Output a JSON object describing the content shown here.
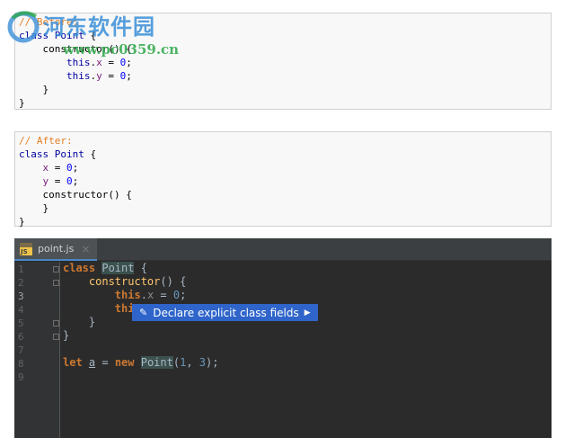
{
  "before_box": {
    "lines": [
      {
        "parts": [
          {
            "t": "// Before:",
            "c": "cmt"
          }
        ]
      },
      {
        "parts": [
          {
            "t": "class ",
            "c": "kw"
          },
          {
            "t": "Point ",
            "c": "cls"
          },
          {
            "t": "{",
            "c": ""
          }
        ]
      },
      {
        "parts": [
          {
            "t": "    constructor() {",
            "c": ""
          }
        ]
      },
      {
        "parts": [
          {
            "t": "        this",
            "c": "kw"
          },
          {
            "t": ".",
            "c": ""
          },
          {
            "t": "x",
            "c": "prop"
          },
          {
            "t": " = ",
            "c": ""
          },
          {
            "t": "0",
            "c": "num"
          },
          {
            "t": ";",
            "c": ""
          }
        ]
      },
      {
        "parts": [
          {
            "t": "        this",
            "c": "kw"
          },
          {
            "t": ".",
            "c": ""
          },
          {
            "t": "y",
            "c": "prop"
          },
          {
            "t": " = ",
            "c": ""
          },
          {
            "t": "0",
            "c": "num"
          },
          {
            "t": ";",
            "c": ""
          }
        ]
      },
      {
        "parts": [
          {
            "t": "    }",
            "c": ""
          }
        ]
      },
      {
        "parts": [
          {
            "t": "}",
            "c": ""
          }
        ]
      }
    ]
  },
  "after_box": {
    "lines": [
      {
        "parts": [
          {
            "t": "// After:",
            "c": "cmt"
          }
        ]
      },
      {
        "parts": [
          {
            "t": "class ",
            "c": "kw"
          },
          {
            "t": "Point ",
            "c": "cls"
          },
          {
            "t": "{",
            "c": ""
          }
        ]
      },
      {
        "parts": [
          {
            "t": "    x",
            "c": "prop"
          },
          {
            "t": " = ",
            "c": ""
          },
          {
            "t": "0",
            "c": "num"
          },
          {
            "t": ";",
            "c": ""
          }
        ]
      },
      {
        "parts": [
          {
            "t": "    y",
            "c": "prop"
          },
          {
            "t": " = ",
            "c": ""
          },
          {
            "t": "0",
            "c": "num"
          },
          {
            "t": ";",
            "c": ""
          }
        ]
      },
      {
        "parts": [
          {
            "t": "    constructor() {",
            "c": ""
          }
        ]
      },
      {
        "parts": [
          {
            "t": "    }",
            "c": ""
          }
        ]
      },
      {
        "parts": [
          {
            "t": "}",
            "c": ""
          }
        ]
      }
    ]
  },
  "watermark": {
    "title": "河东软件园",
    "url": "www.pc0359.cn"
  },
  "editor": {
    "tab": {
      "label": "point.js",
      "icon_text": "JS",
      "close": "×"
    },
    "line_numbers": [
      "1",
      "2",
      "3",
      "4",
      "5",
      "6",
      "7",
      "8",
      "9"
    ],
    "active_line": "3",
    "code_lines": [
      {
        "parts": [
          {
            "t": "class ",
            "c": "d-kw"
          },
          {
            "t": "Point",
            "c": "d-cls"
          },
          {
            "t": " {",
            "c": ""
          }
        ]
      },
      {
        "parts": [
          {
            "t": "    ",
            "c": ""
          },
          {
            "t": "constructor",
            "c": "d-fn"
          },
          {
            "t": "() {",
            "c": ""
          }
        ]
      },
      {
        "parts": [
          {
            "t": "        ",
            "c": ""
          },
          {
            "t": "this",
            "c": "d-this"
          },
          {
            "t": ".",
            "c": ""
          },
          {
            "t": "x",
            "c": "d-dim"
          },
          {
            "t": " = ",
            "c": ""
          },
          {
            "t": "0",
            "c": "d-num"
          },
          {
            "t": ";",
            "c": ""
          }
        ]
      },
      {
        "parts": [
          {
            "t": "        ",
            "c": ""
          },
          {
            "t": "thi",
            "c": "d-this"
          }
        ]
      },
      {
        "parts": [
          {
            "t": "    }",
            "c": ""
          }
        ]
      },
      {
        "parts": [
          {
            "t": "}",
            "c": ""
          }
        ]
      },
      {
        "parts": [
          {
            "t": "",
            "c": ""
          }
        ]
      },
      {
        "parts": [
          {
            "t": "let ",
            "c": "d-kw"
          },
          {
            "t": "a",
            "c": "d-u"
          },
          {
            "t": " = ",
            "c": ""
          },
          {
            "t": "new ",
            "c": "d-kw"
          },
          {
            "t": "Point",
            "c": "d-cls"
          },
          {
            "t": "(",
            "c": ""
          },
          {
            "t": "1",
            "c": "d-num"
          },
          {
            "t": ", ",
            "c": ""
          },
          {
            "t": "3",
            "c": "d-num"
          },
          {
            "t": ");",
            "c": ""
          }
        ]
      },
      {
        "parts": [
          {
            "t": "",
            "c": ""
          }
        ]
      }
    ],
    "intention": {
      "label": "Declare explicit class fields",
      "icon": "intention-bulb-icon",
      "arrow": "▶"
    }
  },
  "colors": {
    "editor_bg": "#2b2b2b",
    "intention_bg": "#2f65ca",
    "keyword_dark": "#cc7832",
    "comment_light": "#e67e22"
  }
}
